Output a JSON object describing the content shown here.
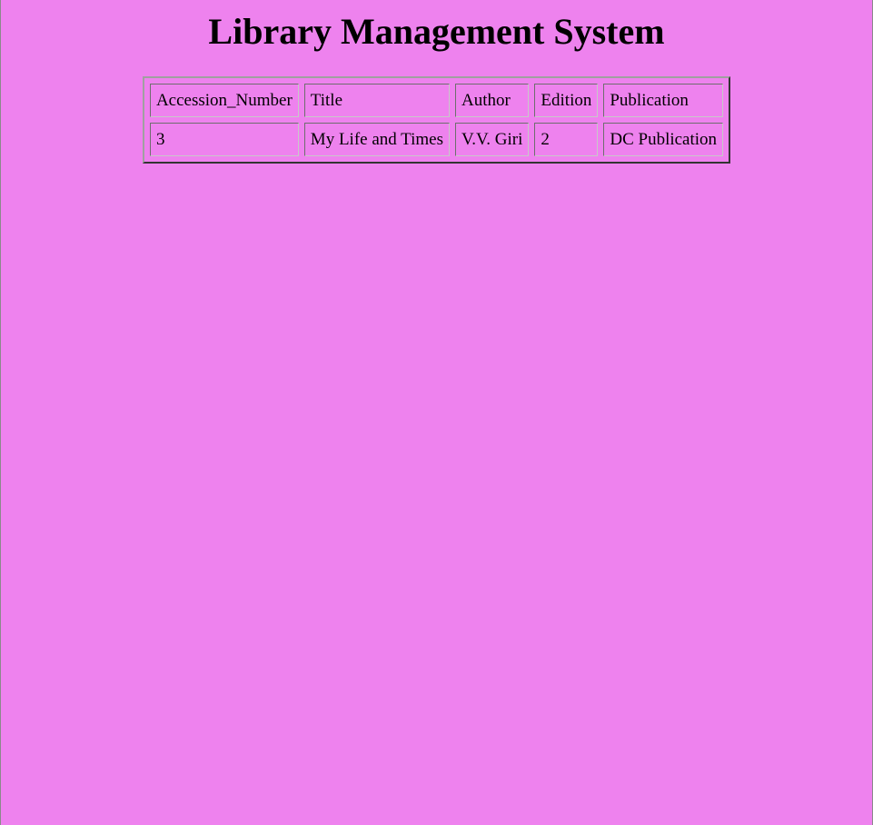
{
  "colors": {
    "background": "#ee82ee"
  },
  "page": {
    "title": "Library Management System"
  },
  "table": {
    "headers": [
      "Accession_Number",
      "Title",
      "Author",
      "Edition",
      "Publication"
    ],
    "rows": [
      [
        "3",
        "My Life and Times",
        "V.V. Giri",
        "2",
        "DC Publication"
      ]
    ]
  }
}
